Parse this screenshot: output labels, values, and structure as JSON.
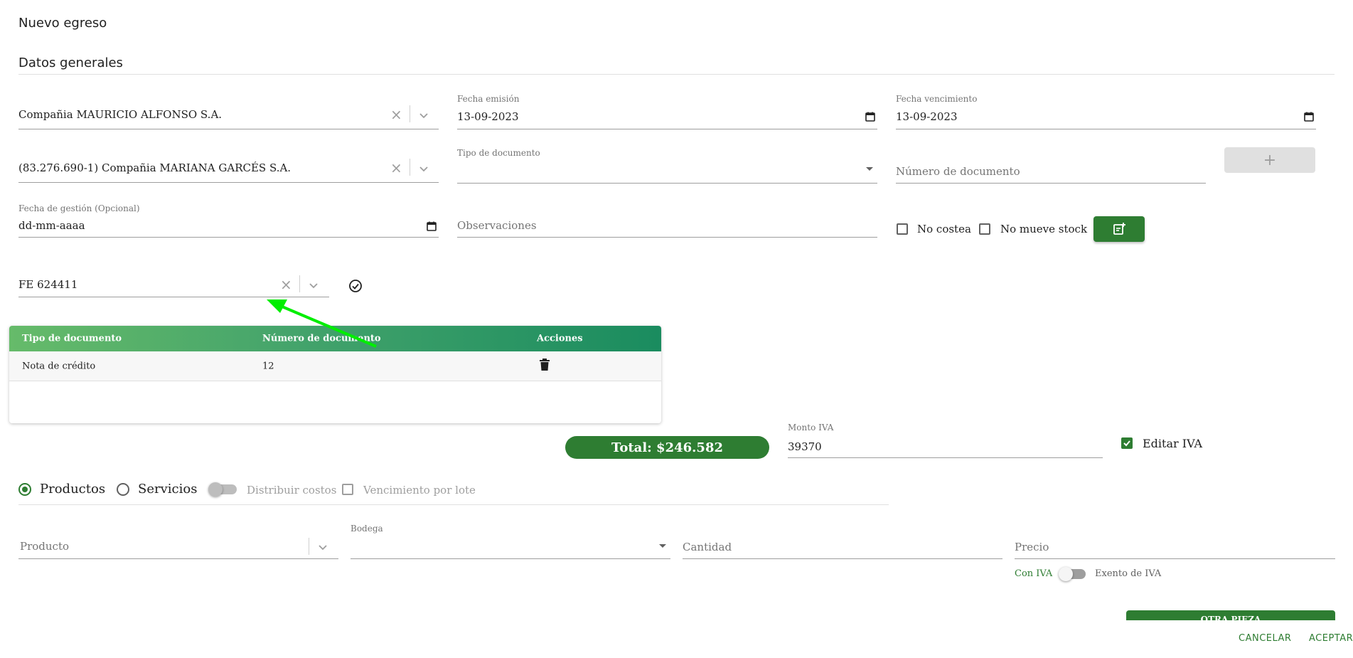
{
  "page": {
    "title": "Nuevo egreso",
    "section": "Datos generales"
  },
  "company": {
    "value": "Compañia MAURICIO ALFONSO S.A."
  },
  "supplier": {
    "value": "(83.276.690-1) Compañia MARIANA GARCÉS S.A."
  },
  "issue_date": {
    "label": "Fecha emisión",
    "value": "13-09-2023"
  },
  "due_date": {
    "label": "Fecha vencimiento",
    "value": "13-09-2023"
  },
  "doc_type": {
    "label": "Tipo de documento",
    "value": ""
  },
  "doc_number": {
    "placeholder": "Número de documento"
  },
  "add_button": {
    "label": "+"
  },
  "mgmt_date": {
    "label": "Fecha de gestión (Opcional)",
    "value": "dd-mm-aaaa"
  },
  "observations": {
    "placeholder": "Observaciones"
  },
  "no_costea": {
    "label": "No costea",
    "checked": false
  },
  "no_mueve_stock": {
    "label": "No mueve stock",
    "checked": false
  },
  "reference": {
    "value": "FE 624411"
  },
  "table": {
    "headers": [
      "Tipo de documento",
      "Número de documento",
      "Acciones"
    ],
    "rows": [
      {
        "tipo": "Nota de crédito",
        "numero": "12"
      }
    ]
  },
  "total": {
    "label": "Total: $246.582"
  },
  "iva": {
    "label": "Monto IVA",
    "value": "39370"
  },
  "edit_iva": {
    "label": "Editar IVA",
    "checked": true
  },
  "item_type": {
    "productos": "Productos",
    "servicios": "Servicios",
    "selected": "Productos"
  },
  "distribuir_costos": {
    "label": "Distribuir costos",
    "on": false
  },
  "vencimiento_lote": {
    "label": "Vencimiento por lote",
    "checked": false
  },
  "product": {
    "placeholder": "Producto"
  },
  "warehouse": {
    "label": "Bodega",
    "value": ""
  },
  "quantity": {
    "placeholder": "Cantidad"
  },
  "price": {
    "placeholder": "Precio"
  },
  "iva_toggle": {
    "left": "Con IVA",
    "right": "Exento de IVA"
  },
  "footer": {
    "cancel": "CANCELAR",
    "accept": "ACEPTAR",
    "hidden_button": "OTRA PIEZA"
  },
  "colors": {
    "primary": "#2e7d32",
    "arrow": "#00ee00"
  },
  "icons": [
    "clear-icon",
    "chevron-down-icon",
    "calendar-icon",
    "check-circle-icon",
    "note-add-icon",
    "trash-icon"
  ]
}
